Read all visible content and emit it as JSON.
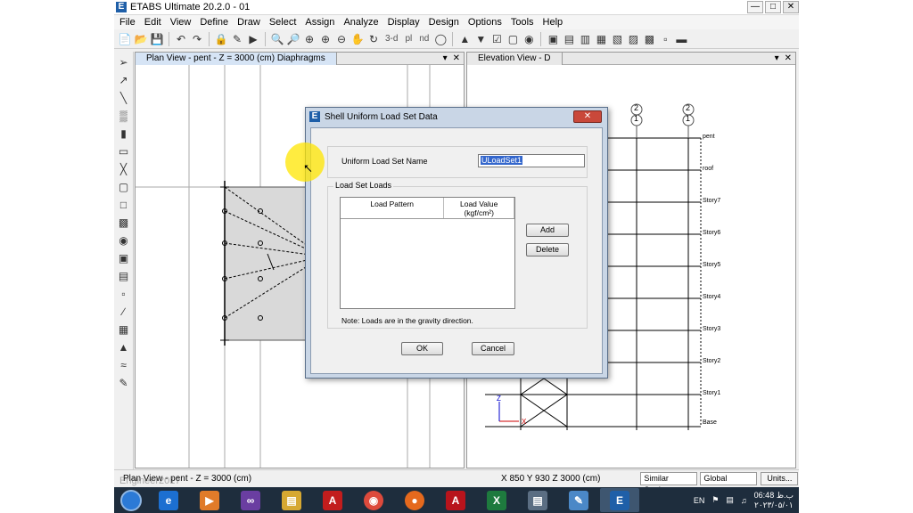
{
  "app": {
    "title": "ETABS Ultimate 20.2.0 - 01",
    "icon_letter": "E",
    "win_controls": [
      "—",
      "□",
      "✕"
    ]
  },
  "menu": [
    "File",
    "Edit",
    "View",
    "Define",
    "Draw",
    "Select",
    "Assign",
    "Analyze",
    "Display",
    "Design",
    "Options",
    "Tools",
    "Help"
  ],
  "toolbar": {
    "three_d": "3-d",
    "plan": "pl",
    "nd": "nd"
  },
  "panes": {
    "plan_title": "Plan View - pent - Z = 3000 (cm)  Diaphragms",
    "elevation_title": "Elevation View - D",
    "pane_ctrls": [
      "▾",
      "✕"
    ]
  },
  "elevation": {
    "story_labels": [
      "pent",
      "roof",
      "Story7",
      "Story6",
      "Story5",
      "Story4",
      "Story3",
      "Story2",
      "Story1",
      "Base"
    ],
    "grid_bubbles": [
      "2",
      "1",
      "2",
      "1"
    ],
    "axis_x": "X",
    "axis_z": "Z"
  },
  "dialog": {
    "title": "Shell Uniform Load Set Data",
    "name_label": "Uniform Load Set Name",
    "name_value": "ULoadSet1",
    "group_title": "Load Set Loads",
    "col_pattern": "Load Pattern",
    "col_value_1": "Load Value",
    "col_value_2": "(kgf/cm²)",
    "add_label": "Add",
    "delete_label": "Delete",
    "note": "Note:  Loads are in the gravity direction.",
    "ok_label": "OK",
    "cancel_label": "Cancel"
  },
  "status": {
    "view_text": "Plan View - pent - Z = 3000 (cm)",
    "coords": "X 850  Y 930  Z 3000 (cm)",
    "stories_combo": "Similar Stories",
    "coord_combo": "Global",
    "units_btn": "Units..."
  },
  "taskbar": {
    "lang": "EN",
    "time": "06:48 ب.ظ",
    "date": "۲۰۲۳/۰۵/۰۱"
  },
  "watermark": "Engineer2017"
}
